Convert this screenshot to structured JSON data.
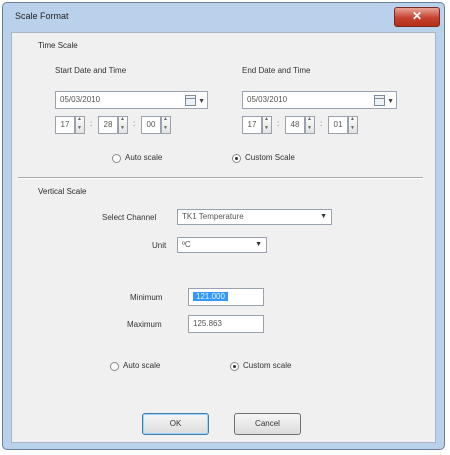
{
  "window": {
    "title": "Scale Format",
    "close_glyph": "✕"
  },
  "time_scale": {
    "group_label": "Time Scale",
    "start": {
      "label": "Start Date and Time",
      "date": "05/03/2010",
      "hour": "17",
      "minute": "28",
      "second": "00"
    },
    "end": {
      "label": "End Date and Time",
      "date": "05/03/2010",
      "hour": "17",
      "minute": "48",
      "second": "01"
    },
    "separator": ":",
    "auto_label": "Auto scale",
    "custom_label": "Custom Scale",
    "selected": "custom"
  },
  "vertical_scale": {
    "group_label": "Vertical Scale",
    "channel_label": "Select Channel",
    "channel_value": "TK1 Temperature",
    "unit_label": "Unit",
    "unit_value": "ºC",
    "minimum_label": "Minimum",
    "minimum_value": "121.000",
    "maximum_label": "Maximum",
    "maximum_value": "125.863",
    "auto_label": "Auto scale",
    "custom_label": "Custom scale",
    "selected": "custom"
  },
  "buttons": {
    "ok": "OK",
    "cancel": "Cancel"
  },
  "icons": {
    "calendar": "calendar-icon",
    "dropdown": "chevron-down-icon",
    "spin": "spin-updown-icon",
    "close": "close-icon"
  }
}
